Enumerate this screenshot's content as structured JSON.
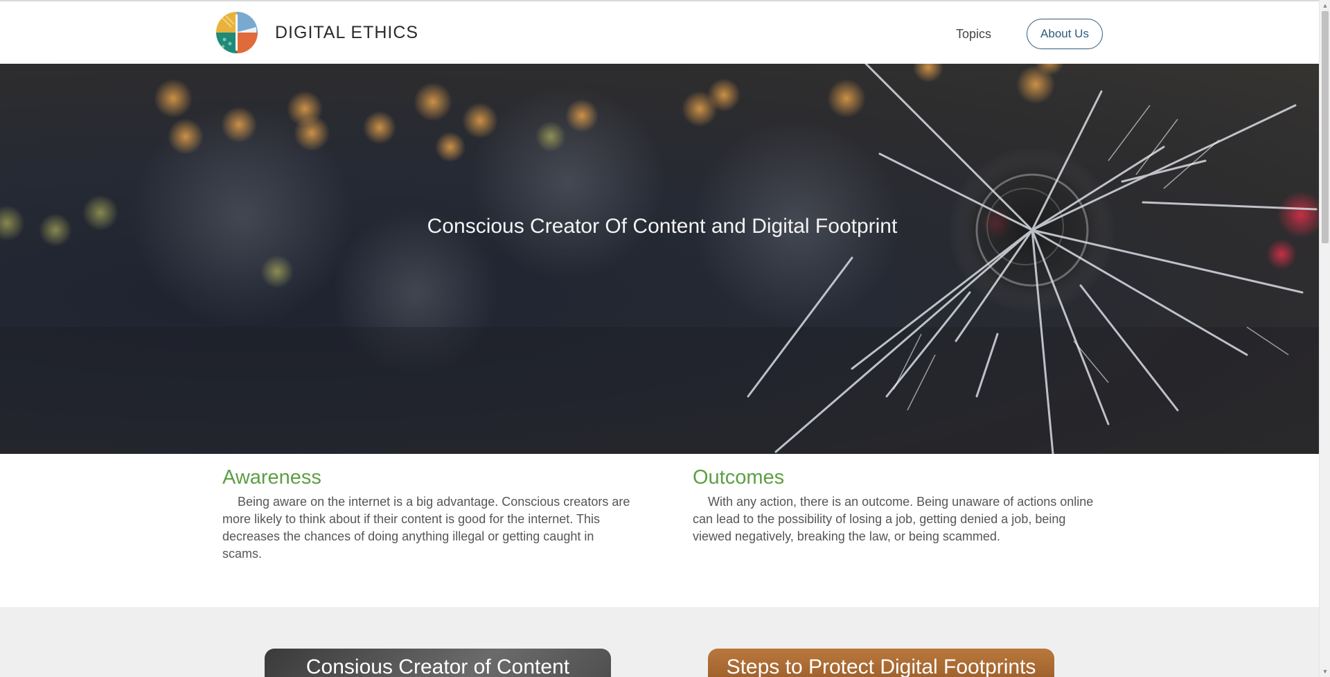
{
  "header": {
    "brand": "DIGITAL ETHICS",
    "nav": {
      "topics": "Topics",
      "about": "About Us"
    }
  },
  "hero": {
    "title": "Conscious Creator Of Content and Digital Footprint"
  },
  "sections": {
    "awareness": {
      "heading": "Awareness",
      "text": "Being aware on the internet is a big advantage. Conscious creators are more likely to think about if their content is good for the internet. This decreases the chances of doing anything illegal or getting caught in scams."
    },
    "outcomes": {
      "heading": "Outcomes",
      "text": "With any action, there is an outcome. Being unaware of actions online can lead to the possibility of losing a job, getting denied a job, being viewed negatively, breaking the law, or being scammed."
    }
  },
  "cards": [
    {
      "label": "Consious Creator of Content"
    },
    {
      "label": "Steps to Protect Digital Footprints"
    }
  ],
  "colors": {
    "accent_green": "#5c9f45",
    "nav_button_blue": "#2e5a7a"
  }
}
